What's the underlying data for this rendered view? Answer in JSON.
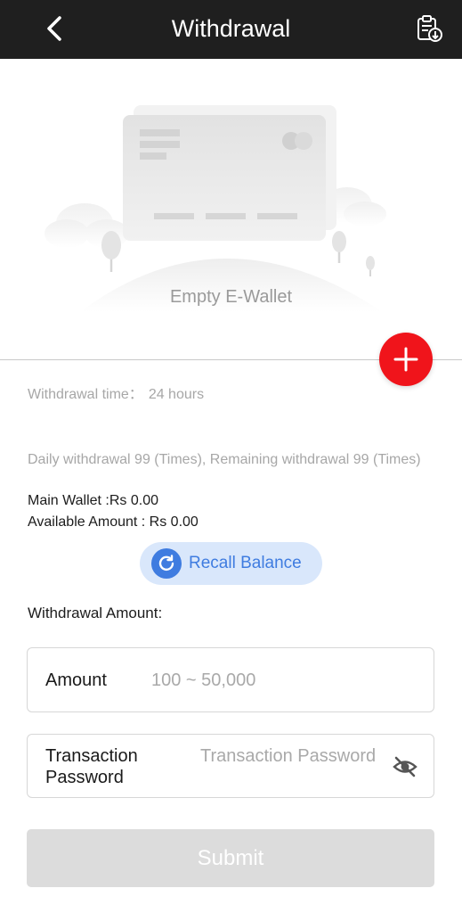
{
  "header": {
    "title": "Withdrawal",
    "back_icon": "chevron-left-icon",
    "record_icon": "clipboard-download-icon"
  },
  "wallet": {
    "empty_text": "Empty E-Wallet",
    "add_icon": "plus-icon"
  },
  "info": {
    "withdrawal_time_label": "Withdrawal time：",
    "withdrawal_time_value": "24 hours",
    "daily_limit_text": "Daily withdrawal 99 (Times), Remaining withdrawal 99 (Times)",
    "main_wallet": "Main Wallet :Rs 0.00",
    "available_amount": "Available Amount : Rs 0.00"
  },
  "recall": {
    "label": "Recall Balance",
    "icon": "refresh-icon"
  },
  "form": {
    "heading": "Withdrawal Amount:",
    "amount_label": "Amount",
    "amount_placeholder": "100 ~ 50,000",
    "password_label": "Transaction Password",
    "password_placeholder": "Transaction Password",
    "eye_icon": "eye-off-icon",
    "submit_label": "Submit"
  },
  "colors": {
    "header_bg": "#1f1f1f",
    "accent_red": "#f0141b",
    "accent_blue": "#3f7ce0",
    "recall_bg": "#d9e7fb",
    "submit_disabled": "#dcdcdc"
  }
}
